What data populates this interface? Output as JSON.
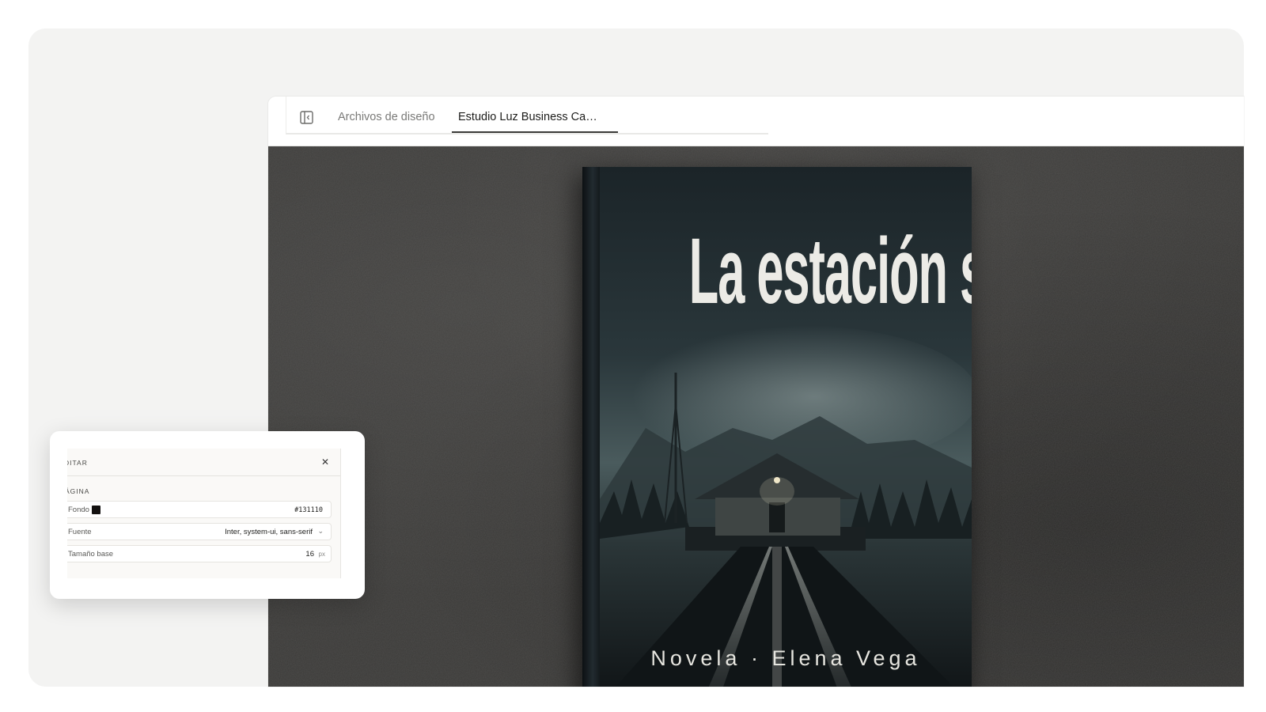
{
  "tabs": {
    "sidebar_toggle_icon": "sidebar-panel-icon",
    "items": [
      {
        "label": "Archivos de diseño",
        "active": false
      },
      {
        "label": "Estudio Luz Business Ca…",
        "active": true
      }
    ]
  },
  "book": {
    "title": "La estación silenciosa",
    "author_line": "Novela · Elena Vega",
    "cover_color": "#1a2226",
    "background_color": "#3b3a38"
  },
  "edit_panel": {
    "title": "DITAR",
    "section": "ÁGINA",
    "close_icon": "close-icon",
    "fields": {
      "background": {
        "label": "Fondo",
        "value": "#131110",
        "swatch_color": "#131110"
      },
      "font": {
        "label": "Fuente",
        "value": "Inter, system-ui, sans-serif"
      },
      "base_size": {
        "label": "Tamaño base",
        "value": "16",
        "unit": "px"
      }
    }
  }
}
